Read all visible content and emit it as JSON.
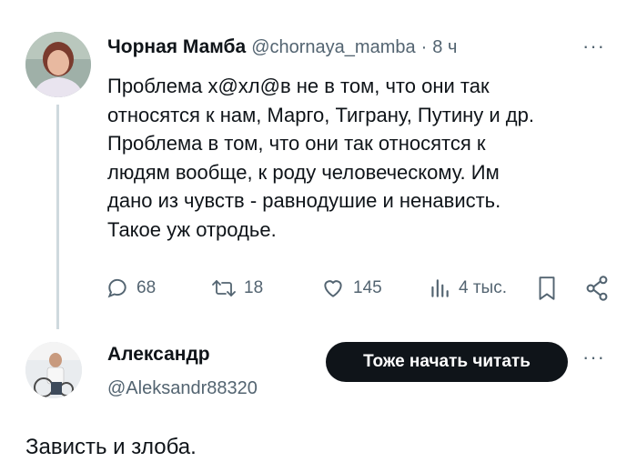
{
  "post": {
    "author_name": "Чорная Мамба",
    "author_handle": "@chornaya_mamba",
    "separator": "·",
    "time": "8 ч",
    "more": "···",
    "text_lines": [
      "Проблема х@хл@в не в том, что они так",
      "относятся к нам, Марго, Тиграну, Путину и др.",
      "Проблема в том, что они так относятся к",
      "людям вообще, к роду человеческому. Им",
      "дано из чувств - равнодушие и ненависть.",
      "Такое уж отродье."
    ],
    "actions": {
      "replies": "68",
      "reposts": "18",
      "likes": "145",
      "views": "4 тыс."
    }
  },
  "reply": {
    "author_name": "Александр",
    "author_handle": "@Aleksandr88320",
    "follow_label": "Тоже начать читать",
    "more": "···",
    "text": "Зависть и злоба."
  },
  "icons": {
    "reply": "comment-icon",
    "repost": "repost-icon",
    "like": "heart-icon",
    "views": "views-icon",
    "bookmark": "bookmark-icon",
    "share": "share-icon"
  },
  "colors": {
    "text": "#0f1419",
    "muted": "#536471",
    "thread_line": "#cfd9de",
    "button_bg": "#0f1419"
  }
}
